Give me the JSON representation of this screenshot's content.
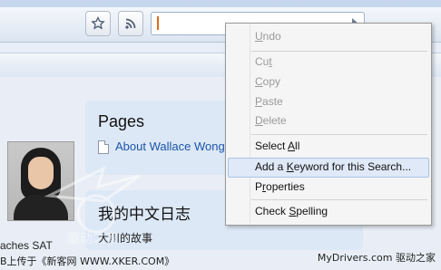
{
  "browser": {
    "toolbar": {
      "bookmark_icon": "star-icon",
      "feed_icon": "rss-icon",
      "url_value": ""
    }
  },
  "sidebar": {
    "pages": {
      "title": "Pages",
      "items": [
        {
          "label": "About Wallace Wong"
        }
      ]
    },
    "profile": {
      "caption_line1": "aches SAT",
      "caption_line2": "B上传于《新客网 WWW.XKER.COM》"
    }
  },
  "blog": {
    "title": "我的中文日志",
    "subtitle": "大川的故事"
  },
  "context_menu": {
    "items": [
      {
        "label": "Undo",
        "underline": "U",
        "rest": "ndo",
        "enabled": false
      },
      {
        "label": "Cut",
        "underline": "t",
        "enabled": false
      },
      {
        "label": "Copy",
        "underline": "C",
        "enabled": false
      },
      {
        "label": "Paste",
        "underline": "P",
        "enabled": false
      },
      {
        "label": "Delete",
        "underline": "D",
        "enabled": false
      },
      {
        "label": "Select All",
        "underline": "A",
        "enabled": true
      },
      {
        "label": "Add a Keyword for this Search...",
        "underline": "K",
        "enabled": true,
        "highlighted": true
      },
      {
        "label": "Properties",
        "underline": "r",
        "enabled": true
      },
      {
        "label": "Check Spelling",
        "underline": "S",
        "enabled": true
      }
    ]
  },
  "watermark": {
    "text": "驱动之家"
  },
  "credit": {
    "site": "MyDrivers.com",
    "brand": "驱动之家"
  },
  "colors": {
    "link": "#1a55a8",
    "menu_highlight": "#dfe9f7",
    "disabled_text": "#9a9a9a"
  }
}
